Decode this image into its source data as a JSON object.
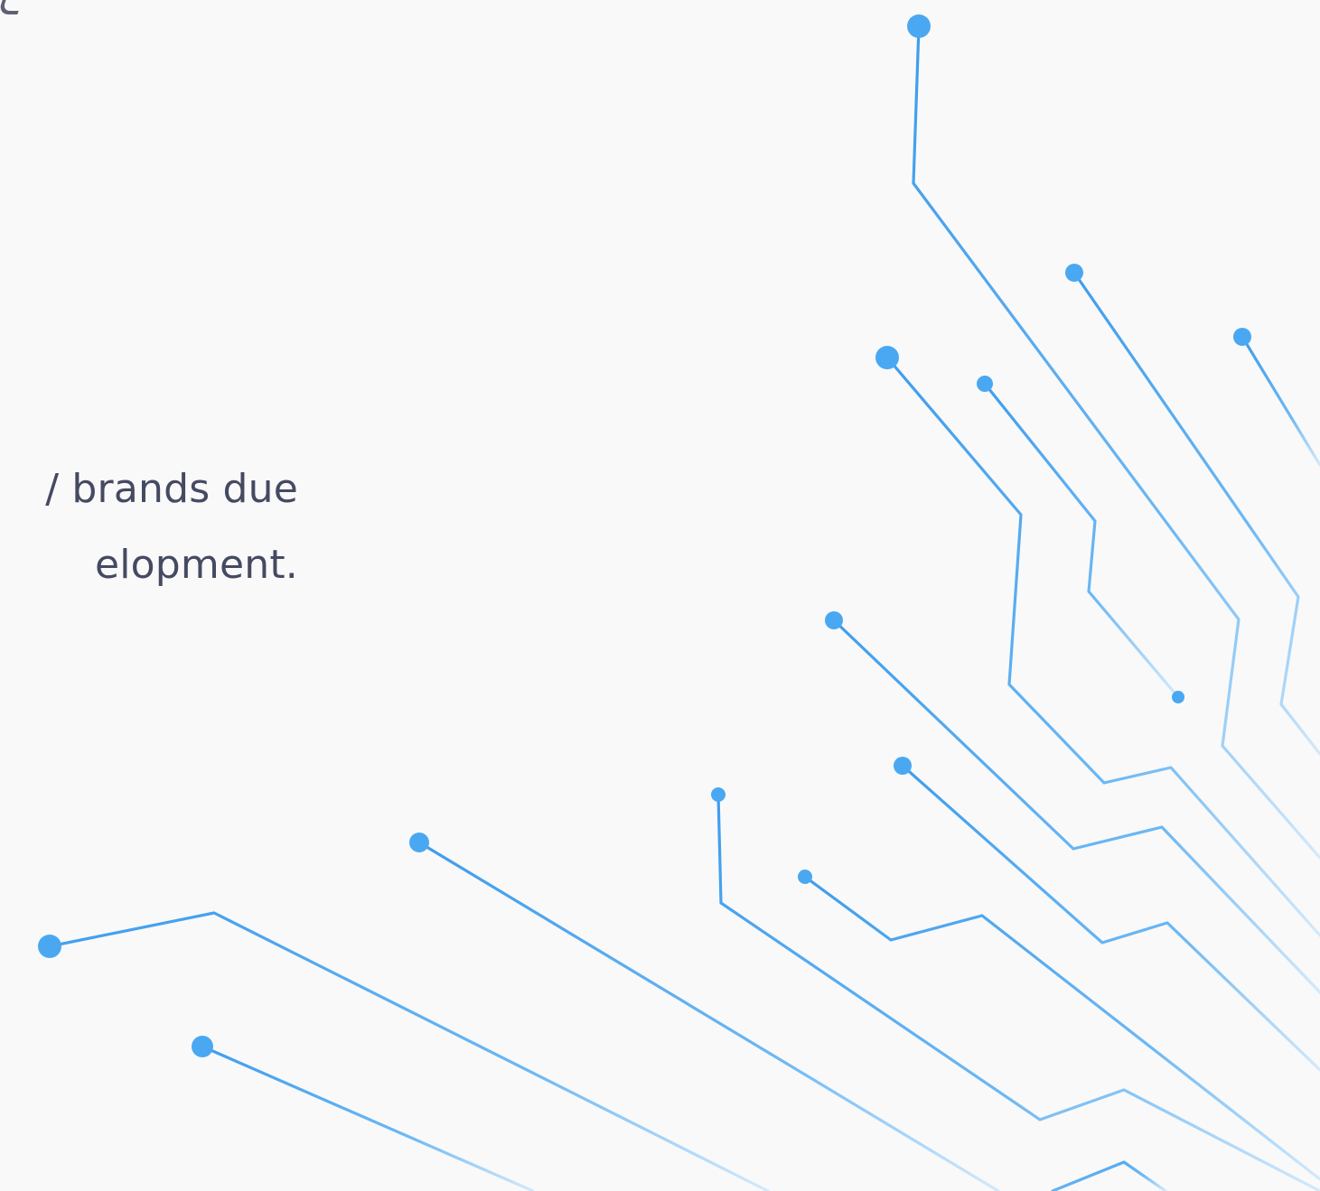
{
  "content": {
    "paragraph_lines": [
      "/ brands due",
      "elopment."
    ]
  },
  "graphic": {
    "name": "circuit-lines",
    "colors": {
      "background": "#f9f9f9",
      "text": "#454a62",
      "line_blue": "#4aa8f2",
      "line_fade": "#cfe6fb"
    }
  }
}
